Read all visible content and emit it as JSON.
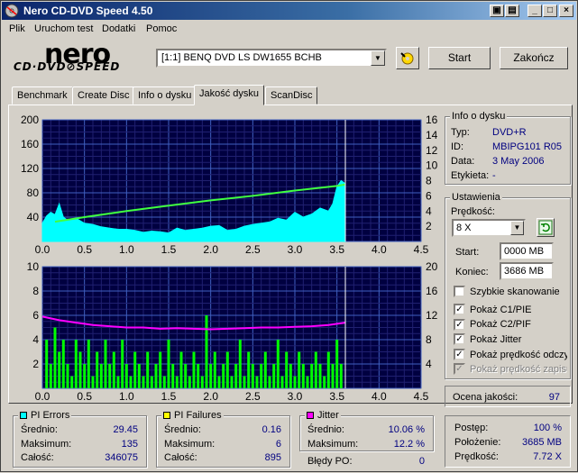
{
  "window": {
    "title": "Nero CD-DVD Speed 4.50"
  },
  "menu": [
    "Plik",
    "Uruchom test",
    "Dodatki",
    "Pomoc"
  ],
  "logo": {
    "brand": "nero",
    "product": "CD·DVD⊘SPEED"
  },
  "drive": {
    "selected": "[1:1]  BENQ DVD LS DW1655 BCHB"
  },
  "buttons": {
    "start": "Start",
    "stop": "Zakończ"
  },
  "tabs": [
    "Benchmark",
    "Create Disc",
    "Info o dysku",
    "Jakość dysku",
    "ScanDisc"
  ],
  "active_tab": 3,
  "disc_info": {
    "title": "Info o dysku",
    "type_label": "Typ:",
    "type": "DVD+R",
    "id_label": "ID:",
    "id": "MBIPG101 R05",
    "date_label": "Data:",
    "date": "3 May 2006",
    "label_label": "Etykieta:",
    "label": "-"
  },
  "settings": {
    "title": "Ustawienia",
    "speed_label": "Prędkość:",
    "speed": "8 X",
    "start_label": "Start:",
    "start": "0000 MB",
    "end_label": "Koniec:",
    "end": "3686 MB",
    "checks": [
      {
        "label": "Szybkie skanowanie",
        "checked": false,
        "disabled": false
      },
      {
        "label": "Pokaż C1/PIE",
        "checked": true,
        "disabled": false
      },
      {
        "label": "Pokaż C2/PIF",
        "checked": true,
        "disabled": false
      },
      {
        "label": "Pokaż Jitter",
        "checked": true,
        "disabled": false
      },
      {
        "label": "Pokaż prędkość odczy",
        "checked": true,
        "disabled": false
      },
      {
        "label": "Pokaż prędkość zapisu",
        "checked": true,
        "disabled": true
      }
    ]
  },
  "quality": {
    "label": "Ocena jakości:",
    "value": "97"
  },
  "pi_errors": {
    "title": "PI Errors",
    "color": "#00ffff",
    "avg_label": "Średnio:",
    "avg": "29.45",
    "max_label": "Maksimum:",
    "max": "135",
    "total_label": "Całość:",
    "total": "346075"
  },
  "pi_failures": {
    "title": "PI Failures",
    "color": "#ffff00",
    "avg_label": "Średnio:",
    "avg": "0.16",
    "max_label": "Maksimum:",
    "max": "6",
    "total_label": "Całość:",
    "total": "895"
  },
  "jitter": {
    "title": "Jitter",
    "color": "#ff00ff",
    "avg_label": "Średnio:",
    "avg": "10.06 %",
    "max_label": "Maksimum:",
    "max": "12.2 %",
    "po_label": "Błędy PO:",
    "po": "0"
  },
  "progress": {
    "progress_label": "Postęp:",
    "progress": "100 %",
    "position_label": "Położenie:",
    "position": "3685 MB",
    "speed_label": "Prędkość:",
    "speed": "7.72 X"
  },
  "chart_data": [
    {
      "type": "area",
      "name": "PI Errors chart",
      "x_ticks": [
        "0.0",
        "0.5",
        "1.0",
        "1.5",
        "2.0",
        "2.5",
        "3.0",
        "3.5",
        "4.0",
        "4.5"
      ],
      "y_left_ticks": [
        "40",
        "80",
        "120",
        "160",
        "200"
      ],
      "y_right_ticks": [
        "2",
        "4",
        "6",
        "8",
        "10",
        "12",
        "14",
        "16"
      ],
      "xlim": [
        0,
        4.5
      ],
      "ylim_left": [
        0,
        200
      ],
      "ylim_right": [
        0,
        16
      ],
      "end_marker_x": 3.6,
      "series": [
        {
          "kind": "area",
          "color": "#00ffff",
          "x": [
            0.0,
            0.05,
            0.1,
            0.15,
            0.2,
            0.25,
            0.3,
            0.4,
            0.5,
            0.6,
            0.7,
            0.8,
            0.9,
            1.0,
            1.1,
            1.2,
            1.3,
            1.4,
            1.5,
            1.6,
            1.7,
            1.8,
            1.9,
            2.0,
            2.1,
            2.2,
            2.3,
            2.4,
            2.5,
            2.6,
            2.7,
            2.8,
            2.9,
            3.0,
            3.1,
            3.2,
            3.3,
            3.4,
            3.45,
            3.5,
            3.55,
            3.6
          ],
          "y": [
            30,
            42,
            48,
            44,
            62,
            40,
            35,
            38,
            30,
            28,
            24,
            22,
            20,
            20,
            18,
            15,
            17,
            16,
            14,
            22,
            18,
            20,
            22,
            25,
            26,
            18,
            20,
            25,
            28,
            30,
            32,
            38,
            35,
            48,
            40,
            45,
            55,
            50,
            62,
            90,
            100,
            95
          ]
        },
        {
          "kind": "line",
          "color": "#40ff40",
          "axis": "right",
          "x": [
            0.15,
            0.5,
            1.0,
            1.5,
            2.0,
            2.5,
            3.0,
            3.5,
            3.6
          ],
          "y": [
            2.6,
            3.2,
            4.0,
            4.7,
            5.4,
            6.0,
            6.7,
            7.3,
            7.5
          ]
        }
      ]
    },
    {
      "type": "bar",
      "name": "PI Failures chart",
      "x_ticks": [
        "0.0",
        "0.5",
        "1.0",
        "1.5",
        "2.0",
        "2.5",
        "3.0",
        "3.5",
        "4.0",
        "4.5"
      ],
      "y_left_ticks": [
        "2",
        "4",
        "6",
        "8",
        "10"
      ],
      "y_right_ticks": [
        "4",
        "8",
        "12",
        "16",
        "20"
      ],
      "xlim": [
        0,
        4.5
      ],
      "ylim_left": [
        0,
        10
      ],
      "ylim_right": [
        0,
        20
      ],
      "end_marker_x": 3.6,
      "series": [
        {
          "kind": "bars",
          "color": "#00ff00",
          "x": [
            0.05,
            0.1,
            0.15,
            0.2,
            0.25,
            0.3,
            0.35,
            0.4,
            0.45,
            0.5,
            0.55,
            0.6,
            0.65,
            0.7,
            0.75,
            0.8,
            0.85,
            0.9,
            0.95,
            1.0,
            1.05,
            1.1,
            1.15,
            1.2,
            1.25,
            1.3,
            1.35,
            1.4,
            1.45,
            1.5,
            1.55,
            1.6,
            1.65,
            1.7,
            1.75,
            1.8,
            1.85,
            1.9,
            1.95,
            2.0,
            2.05,
            2.1,
            2.15,
            2.2,
            2.25,
            2.3,
            2.35,
            2.4,
            2.45,
            2.5,
            2.55,
            2.6,
            2.65,
            2.7,
            2.75,
            2.8,
            2.85,
            2.9,
            2.95,
            3.0,
            3.05,
            3.1,
            3.15,
            3.2,
            3.25,
            3.3,
            3.35,
            3.4,
            3.45,
            3.5,
            3.55
          ],
          "y": [
            4,
            2,
            5,
            3,
            4,
            2,
            1,
            4,
            3,
            2,
            4,
            1,
            3,
            2,
            4,
            2,
            3,
            1,
            4,
            2,
            1,
            3,
            2,
            1,
            3,
            1,
            2,
            3,
            1,
            4,
            2,
            1,
            3,
            2,
            1,
            3,
            2,
            1,
            6,
            2,
            3,
            1,
            2,
            3,
            1,
            2,
            4,
            1,
            3,
            2,
            1,
            2,
            3,
            1,
            2,
            4,
            1,
            3,
            2,
            1,
            3,
            2,
            1,
            2,
            3,
            2,
            1,
            3,
            2,
            4,
            2
          ]
        },
        {
          "kind": "line",
          "color": "#ff00ff",
          "axis": "right",
          "x": [
            0.0,
            0.1,
            0.2,
            0.3,
            0.4,
            0.5,
            0.6,
            0.8,
            1.0,
            1.2,
            1.4,
            1.6,
            1.8,
            2.0,
            2.2,
            2.4,
            2.6,
            2.8,
            3.0,
            3.2,
            3.4,
            3.5,
            3.6
          ],
          "y": [
            11.8,
            11.5,
            11.2,
            11.0,
            10.8,
            10.6,
            10.4,
            10.2,
            10.0,
            10.0,
            9.8,
            9.9,
            9.8,
            9.7,
            9.8,
            9.9,
            10.0,
            10.0,
            10.1,
            10.2,
            10.4,
            10.6,
            10.8
          ]
        }
      ]
    }
  ]
}
